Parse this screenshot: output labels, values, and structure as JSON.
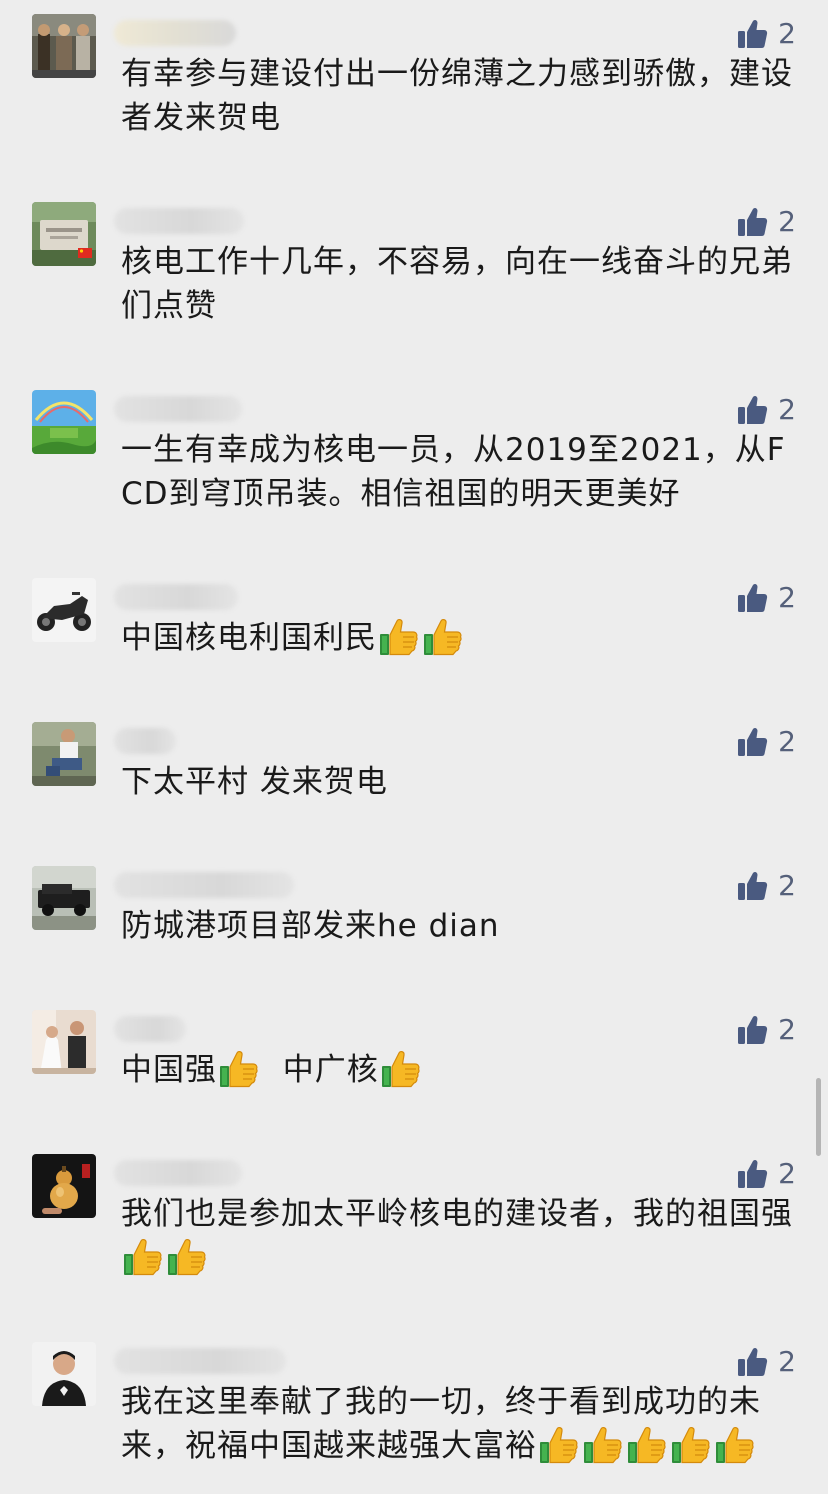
{
  "comments": [
    {
      "text": "有幸参与建设付出一份绵薄之力感到骄傲，建设者发来贺电",
      "likes": "2",
      "emoji_count": 0
    },
    {
      "text": "核电工作十几年，不容易，向在一线奋斗的兄弟们点赞",
      "likes": "2",
      "emoji_count": 0
    },
    {
      "text": "一生有幸成为核电一员，从2019至2021，从FCD到穹顶吊装。相信祖国的明天更美好",
      "likes": "2",
      "emoji_count": 0
    },
    {
      "text": "中国核电利国利民",
      "likes": "2",
      "emoji_count": 2
    },
    {
      "text": "下太平村 发来贺电",
      "likes": "2",
      "emoji_count": 0
    },
    {
      "text": "防城港项目部发来he dian",
      "likes": "2",
      "emoji_count": 0
    },
    {
      "text_a": "中国强",
      "text_b": "中广核",
      "likes": "2"
    },
    {
      "text": "我们也是参加太平岭核电的建设者，我的祖国强",
      "likes": "2",
      "emoji_count": 2
    },
    {
      "text": "我在这里奉献了我的一切，终于看到成功的未来，祝福中国越来越强大富裕",
      "likes": "2",
      "emoji_count": 5
    }
  ],
  "icons": {
    "like": "thumbs-up-icon",
    "emoji": "thumbs-up-emoji-icon"
  },
  "colors": {
    "like_icon": "#4a5a80",
    "background": "#ededed"
  }
}
